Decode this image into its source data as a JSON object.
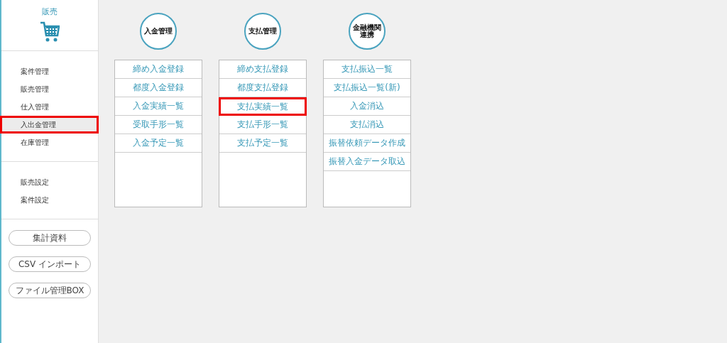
{
  "sidebar": {
    "header": {
      "title": "販売"
    },
    "menu_groups": [
      {
        "items": [
          {
            "label": "案件管理",
            "selected": false,
            "highlighted": false
          },
          {
            "label": "販売管理",
            "selected": false,
            "highlighted": false
          },
          {
            "label": "仕入管理",
            "selected": false,
            "highlighted": false
          },
          {
            "label": "入出金管理",
            "selected": true,
            "highlighted": true
          },
          {
            "label": "在庫管理",
            "selected": false,
            "highlighted": false
          }
        ]
      },
      {
        "items": [
          {
            "label": "販売設定",
            "selected": false,
            "highlighted": false
          },
          {
            "label": "案件設定",
            "selected": false,
            "highlighted": false
          }
        ]
      }
    ],
    "buttons": [
      "集計資料",
      "CSV インポート",
      "ファイル管理BOX"
    ]
  },
  "columns": [
    {
      "title": "入金管理",
      "items": [
        {
          "label": "締め入金登録",
          "highlighted": false
        },
        {
          "label": "都度入金登録",
          "highlighted": false
        },
        {
          "label": "入金実績一覧",
          "highlighted": false
        },
        {
          "label": "受取手形一覧",
          "highlighted": false
        },
        {
          "label": "入金予定一覧",
          "highlighted": false
        }
      ]
    },
    {
      "title": "支払管理",
      "items": [
        {
          "label": "締め支払登録",
          "highlighted": false
        },
        {
          "label": "都度支払登録",
          "highlighted": false
        },
        {
          "label": "支払実績一覧",
          "highlighted": true
        },
        {
          "label": "支払手形一覧",
          "highlighted": false
        },
        {
          "label": "支払予定一覧",
          "highlighted": false
        }
      ]
    },
    {
      "title": "金融機関連携",
      "items": [
        {
          "label": "支払振込一覧",
          "highlighted": false
        },
        {
          "label": "支払振込一覧(新)",
          "highlighted": false
        },
        {
          "label": "入金消込",
          "highlighted": false
        },
        {
          "label": "支払消込",
          "highlighted": false
        },
        {
          "label": "振替依頼データ作成",
          "highlighted": false
        },
        {
          "label": "振替入金データ取込",
          "highlighted": false
        }
      ]
    }
  ]
}
